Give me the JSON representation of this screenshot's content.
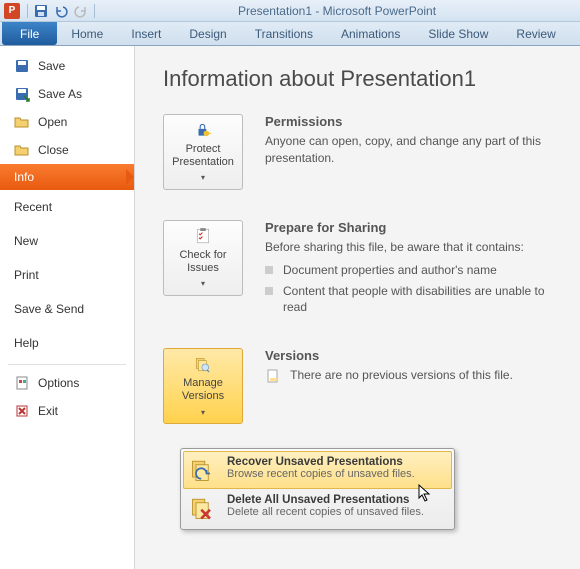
{
  "title": "Presentation1 - Microsoft PowerPoint",
  "app_letter": "P",
  "tabs": {
    "file": "File",
    "home": "Home",
    "insert": "Insert",
    "design": "Design",
    "transitions": "Transitions",
    "animations": "Animations",
    "slideshow": "Slide Show",
    "review": "Review"
  },
  "nav": {
    "save": "Save",
    "saveas": "Save As",
    "open": "Open",
    "close": "Close",
    "info": "Info",
    "recent": "Recent",
    "new": "New",
    "print": "Print",
    "savensend": "Save & Send",
    "help": "Help",
    "options": "Options",
    "exit": "Exit"
  },
  "heading": "Information about Presentation1",
  "permissions": {
    "button": "Protect Presentation",
    "title": "Permissions",
    "desc": "Anyone can open, copy, and change any part of this presentation."
  },
  "sharing": {
    "button": "Check for Issues",
    "title": "Prepare for Sharing",
    "desc": "Before sharing this file, be aware that it contains:",
    "items": [
      "Document properties and author's name",
      "Content that people with disabilities are unable to read"
    ]
  },
  "versions": {
    "button": "Manage Versions",
    "title": "Versions",
    "desc": "There are no previous versions of this file."
  },
  "dropdown": {
    "recover": {
      "title": "Recover Unsaved Presentations",
      "desc": "Browse recent copies of unsaved files."
    },
    "delete": {
      "title": "Delete All Unsaved Presentations",
      "desc": "Delete all recent copies of unsaved files."
    }
  }
}
